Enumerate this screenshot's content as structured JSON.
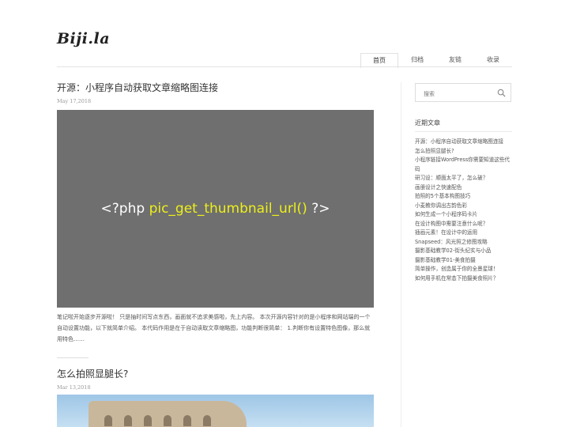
{
  "site": {
    "logo": "Biji.la"
  },
  "nav": [
    {
      "label": "首页",
      "active": true
    },
    {
      "label": "归档",
      "active": false
    },
    {
      "label": "友链",
      "active": false
    },
    {
      "label": "收录",
      "active": false
    }
  ],
  "posts": [
    {
      "title": "开源：小程序自动获取文章缩略图连接",
      "date": "May 17,2018",
      "image_code_prefix": "<?php ",
      "image_code_func": "pic_get_thumbnail_url()",
      "image_code_suffix": " ?>",
      "excerpt": "笔记啦开始逐步开源啦！ 只是抽时间写点东西，画面就不追求美感啦，先上内容。 本次开源内容针对的是小程序和网站端的一个自动设置功能，以下就简单介绍。 本代码作用是在于自动读取文章缩略图，功能判断很简单： 1.判断你有设置特色图像，那么就用特色……"
    },
    {
      "title": "怎么拍照显腿长?",
      "date": "Mar 13,2018"
    }
  ],
  "sidebar": {
    "search_placeholder": "搜索",
    "recent_title": "近期文章",
    "recent_posts": [
      "开源：小程序自动获取文章缩略图连接",
      "怎么拍照显腿长?",
      "小程序链接WordPress你需要知道这些代码",
      "研习设：顺面太平了，怎么破？",
      "画册设计之快速配色",
      "拍照的5个基本构图技巧",
      "小麦教你调出古韵色彩",
      "如何生成一个小程序码卡片",
      "在设计构图中需要注意什么呢？",
      "插画元素！在设计中的运用",
      "Snapseed：风光照之修图攻略",
      "摄影基础教学02-街头纪实与小品",
      "摄影基础教学01-美食拍摄",
      "简单操作，创造属于你的全景星球！",
      "如何用手机在常态下拍摄美食照片？"
    ]
  }
}
